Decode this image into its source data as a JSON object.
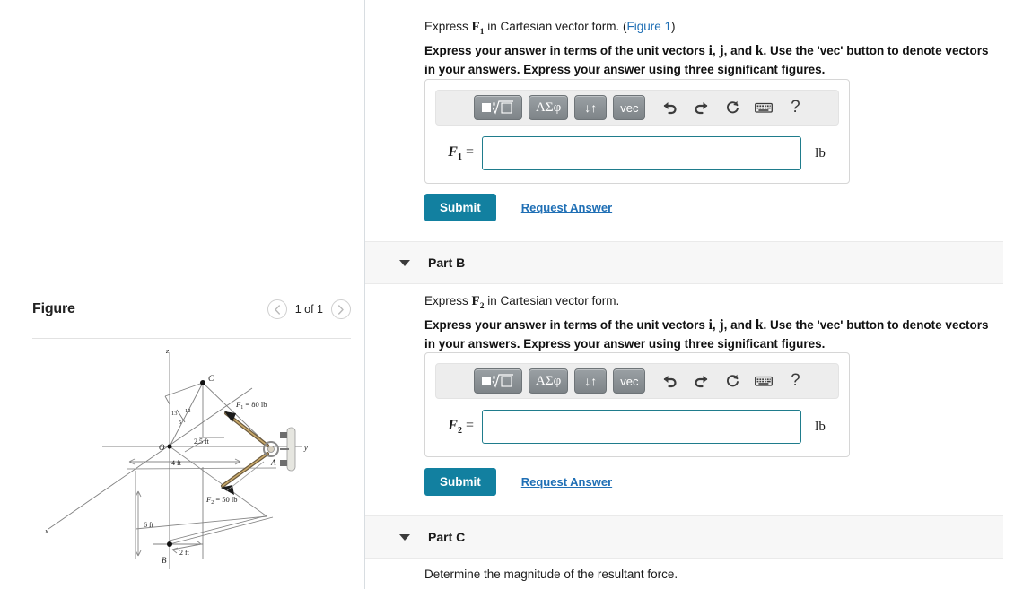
{
  "figure_panel": {
    "title": "Figure",
    "pager": {
      "prev_icon": "chevron-left-icon",
      "next_icon": "chevron-right-icon",
      "count_label": "1 of 1"
    },
    "diagram": {
      "axes": [
        "z",
        "y",
        "x"
      ],
      "points": [
        "O",
        "C",
        "A",
        "B"
      ],
      "force_labels": [
        "F₁ = 80 lb",
        "F₂ = 50 lb"
      ],
      "dimension_labels": [
        "2.5 ft",
        "4 ft",
        "6 ft",
        "2 ft"
      ],
      "ratio_labels": [
        "13",
        "12",
        "5"
      ]
    }
  },
  "parts": [
    {
      "id": "part-a",
      "prompt_pre": "Express ",
      "prompt_var": "F",
      "prompt_sub": "1",
      "prompt_post": " in Cartesian vector form. (",
      "prompt_link": "Figure 1",
      "prompt_end": ")",
      "instruction_pre": "Express your answer in terms of the unit vectors ",
      "uvec_i": "i",
      "uvec_sep1": ", ",
      "uvec_j": "j",
      "uvec_sep2": ", and ",
      "uvec_k": "k",
      "instruction_post": ". Use the 'vec' button to denote vectors in your answers. Express your answer using three significant figures.",
      "answer_label_var": "F",
      "answer_label_sub": "1",
      "answer_label_eq": " =",
      "answer_value": "",
      "answer_unit": "lb",
      "submit_label": "Submit",
      "request_label": "Request Answer"
    },
    {
      "id": "part-b",
      "header": "Part B",
      "prompt_pre": "Express ",
      "prompt_var": "F",
      "prompt_sub": "2",
      "prompt_post": " in Cartesian vector form.",
      "instruction_pre": "Express your answer in terms of the unit vectors ",
      "uvec_i": "i",
      "uvec_sep1": ", ",
      "uvec_j": "j",
      "uvec_sep2": ", and ",
      "uvec_k": "k",
      "instruction_post": ". Use the 'vec' button to denote vectors in your answers. Express your answer using three significant figures.",
      "answer_label_var": "F",
      "answer_label_sub": "2",
      "answer_label_eq": " =",
      "answer_value": "",
      "answer_unit": "lb",
      "submit_label": "Submit",
      "request_label": "Request Answer"
    },
    {
      "id": "part-c",
      "header": "Part C",
      "prompt_plain": "Determine the magnitude of the resultant force."
    }
  ],
  "mathbar": {
    "buttons": [
      {
        "name": "math-template-button",
        "glyph": "■√□"
      },
      {
        "name": "greek-symbols-button",
        "glyph": "ΑΣφ"
      },
      {
        "name": "sort-arrows-button",
        "glyph": "↓↑"
      },
      {
        "name": "vec-button",
        "glyph": "vec"
      }
    ],
    "icons": [
      {
        "name": "undo-icon",
        "glyph": "undo"
      },
      {
        "name": "redo-icon",
        "glyph": "redo"
      },
      {
        "name": "reset-icon",
        "glyph": "reset"
      },
      {
        "name": "keyboard-icon",
        "glyph": "keyboard"
      },
      {
        "name": "help-icon",
        "glyph": "?"
      }
    ]
  },
  "colors": {
    "link": "#1f6fb5",
    "submit": "#1280a0",
    "input_border": "#1f7c8c",
    "band": "#f7f7f7"
  }
}
